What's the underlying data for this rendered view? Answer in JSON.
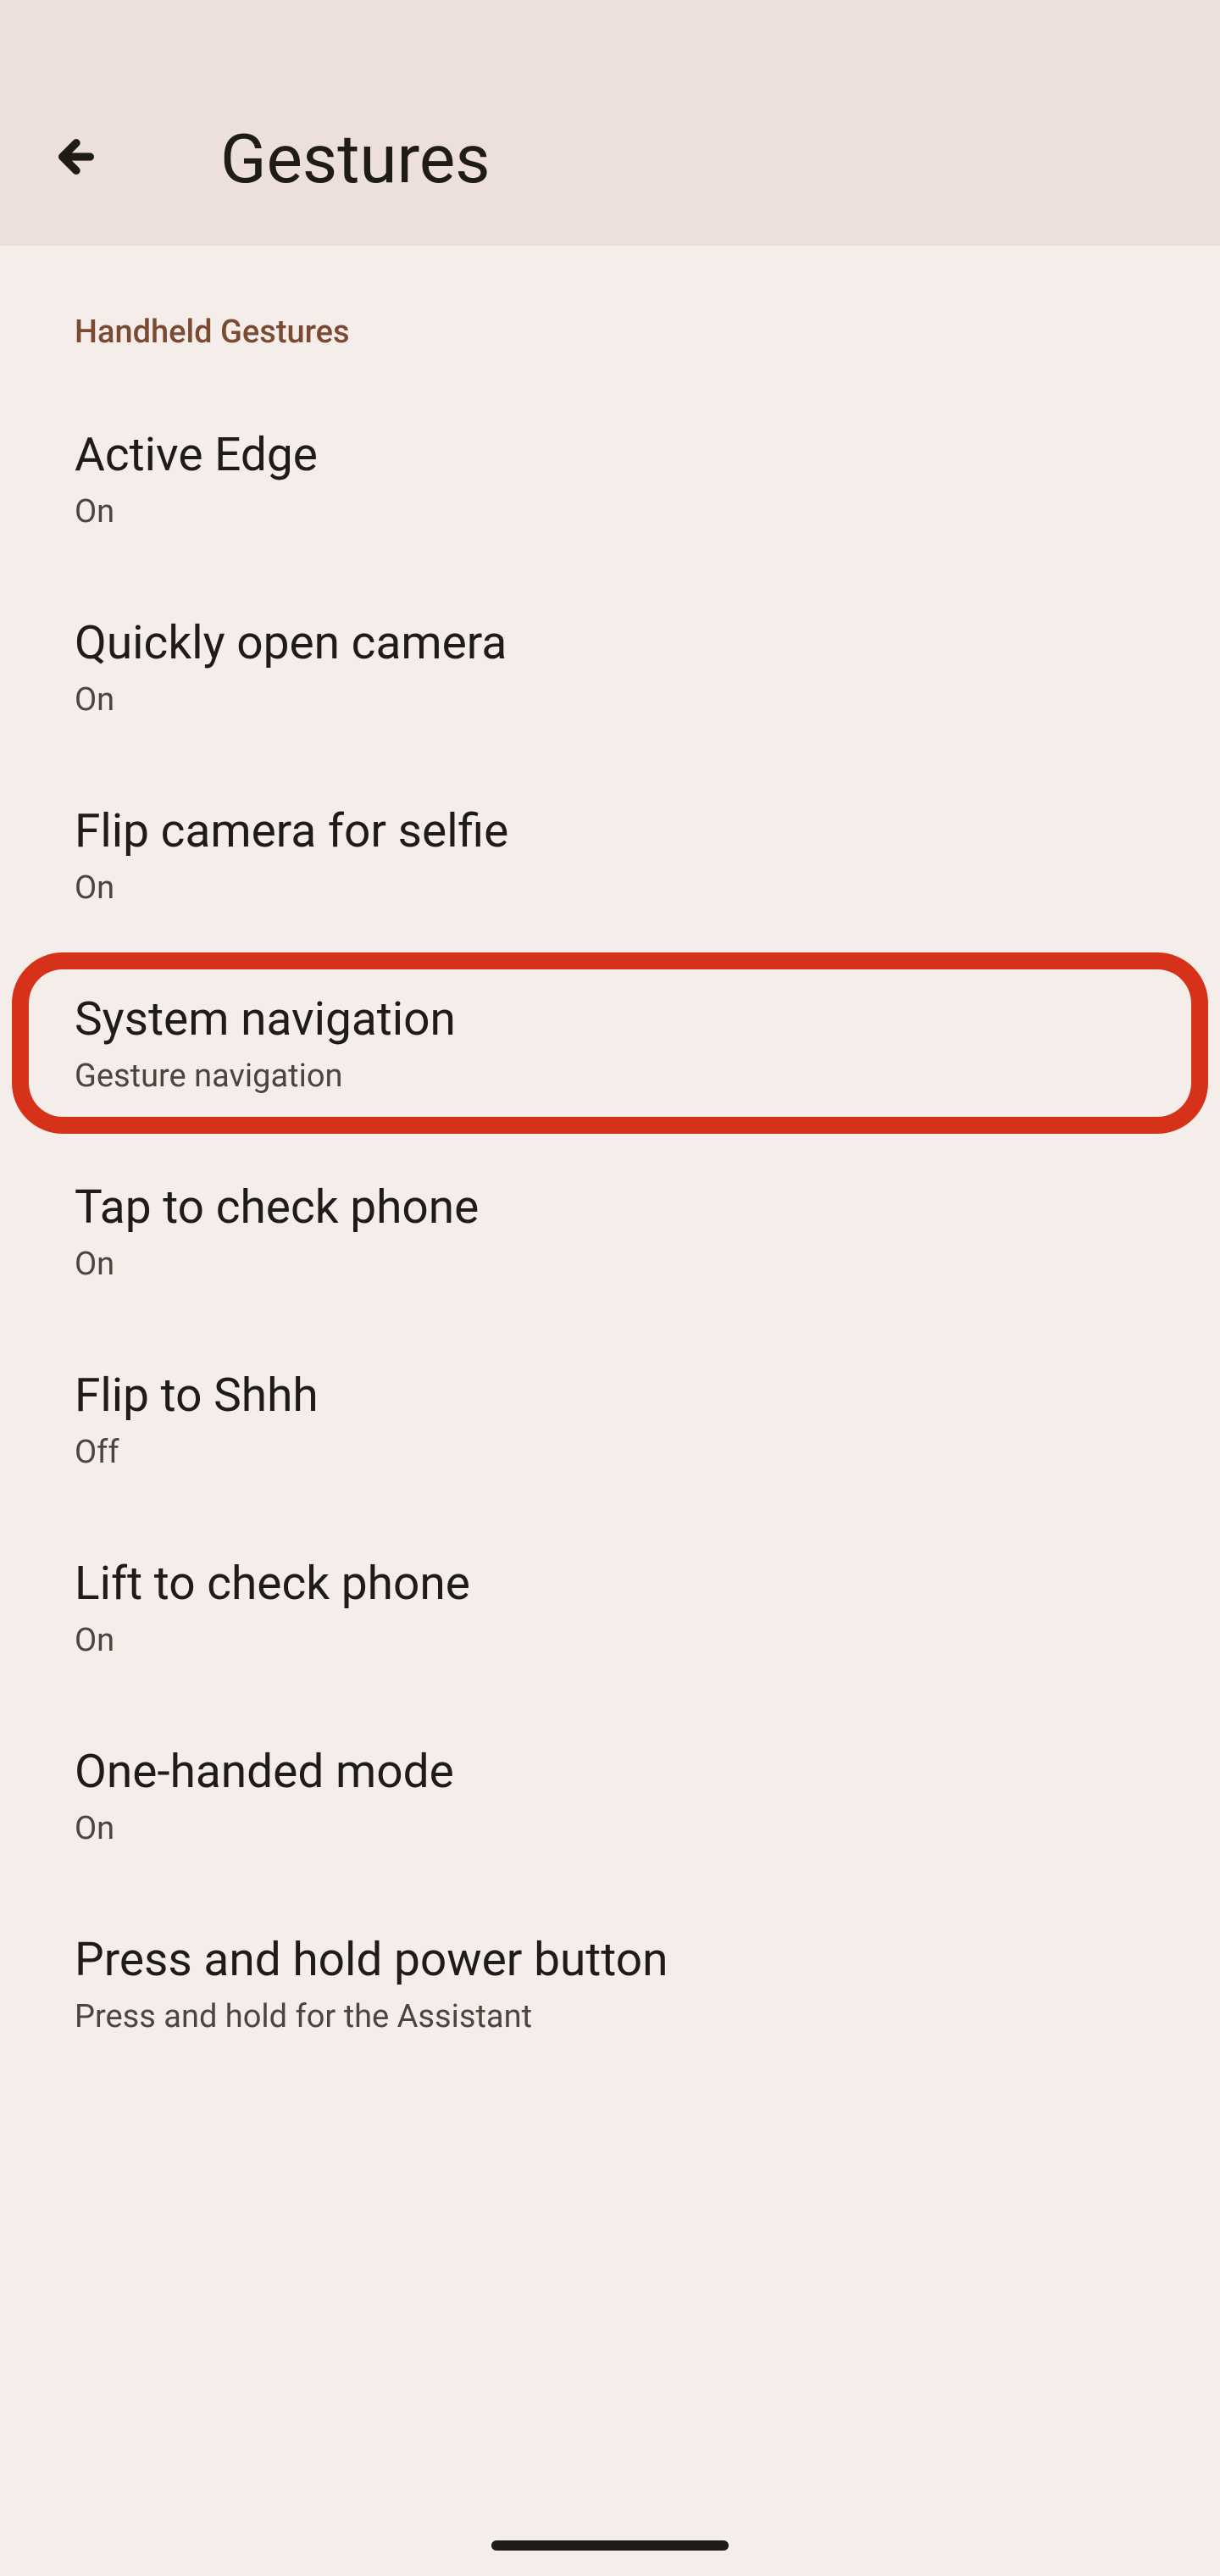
{
  "header": {
    "title": "Gestures"
  },
  "section": {
    "label": "Handheld Gestures"
  },
  "items": [
    {
      "title": "Active Edge",
      "sub": "On",
      "highlighted": false
    },
    {
      "title": "Quickly open camera",
      "sub": "On",
      "highlighted": false
    },
    {
      "title": "Flip camera for selfie",
      "sub": "On",
      "highlighted": false
    },
    {
      "title": "System navigation",
      "sub": "Gesture navigation",
      "highlighted": true
    },
    {
      "title": "Tap to check phone",
      "sub": "On",
      "highlighted": false
    },
    {
      "title": "Flip to Shhh",
      "sub": "Off",
      "highlighted": false
    },
    {
      "title": "Lift to check phone",
      "sub": "On",
      "highlighted": false
    },
    {
      "title": "One-handed mode",
      "sub": "On",
      "highlighted": false
    },
    {
      "title": "Press and hold power button",
      "sub": "Press and hold for the Assistant",
      "highlighted": false
    }
  ]
}
